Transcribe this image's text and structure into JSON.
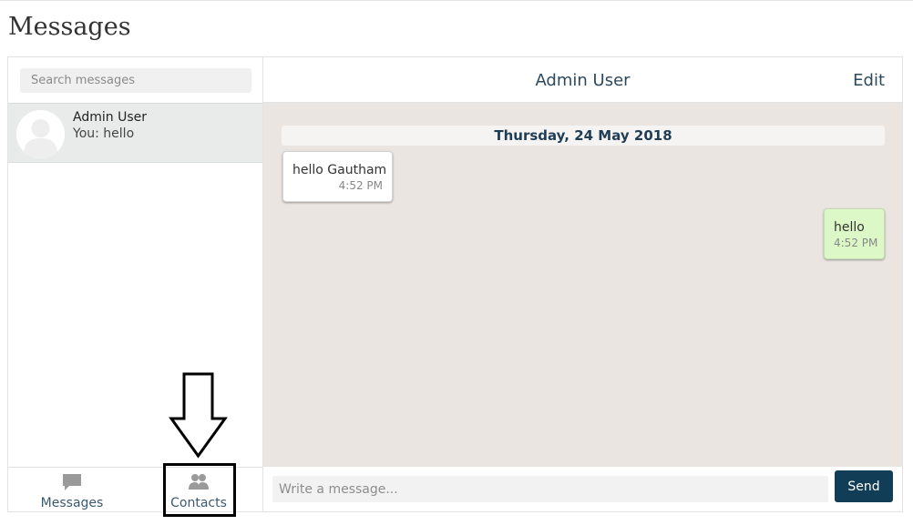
{
  "page": {
    "title": "Messages"
  },
  "sidebar": {
    "search_placeholder": "Search messages",
    "conversations": [
      {
        "name": "Admin User",
        "preview": "You: hello",
        "icon": "avatar-placeholder-icon"
      }
    ],
    "nav": [
      {
        "label": "Messages",
        "icon": "speech-bubble-icon"
      },
      {
        "label": "Contacts",
        "icon": "contacts-icon"
      }
    ]
  },
  "chat": {
    "title": "Admin User",
    "edit_label": "Edit",
    "date_separator": "Thursday, 24 May 2018",
    "messages": [
      {
        "text": "hello Gautham",
        "time": "4:52 PM",
        "direction": "incoming"
      },
      {
        "text": "hello",
        "time": "4:52 PM",
        "direction": "outgoing"
      }
    ],
    "compose_placeholder": "Write a message...",
    "send_label": "Send"
  },
  "colors": {
    "accent": "#123d56",
    "chat_background": "#ebe5e1",
    "outgoing_bubble": "#dcf8c6",
    "selected_conversation": "#e9ebeb"
  }
}
